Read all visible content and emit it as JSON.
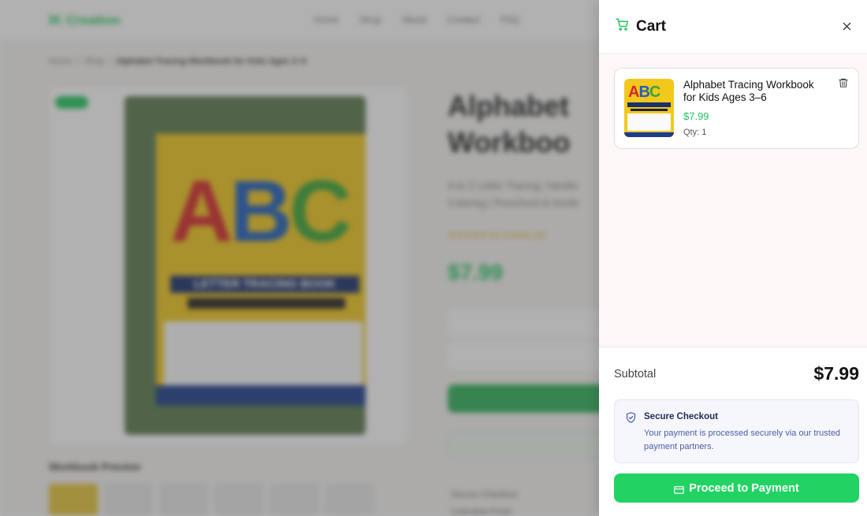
{
  "background": {
    "brand": "IK Creation",
    "nav": [
      "Home",
      "Shop",
      "About",
      "Contact",
      "FAQ"
    ],
    "breadcrumb": [
      "Home",
      "Shop",
      "Alphabet Tracing Workbook for Kids Ages 3–6"
    ],
    "badge": "SALE",
    "cover_text": "ABC",
    "cover_band": "LETTER TRACING BOOK",
    "title_line1": "Alphabet",
    "title_line2": "Workboo",
    "subtitle_line1": "A to Z Letter Tracing, Handw",
    "subtitle_line2": "Coloring | Preschool & Kinde",
    "rating_text": "No reviews yet",
    "price": "$7.99",
    "preview_heading": "Workbook Preview",
    "features": [
      "Secure Checkout",
      "Unlimited Prints"
    ]
  },
  "cart": {
    "title": "Cart",
    "item": {
      "name": "Alphabet Tracing Workbook for Kids Ages 3–6",
      "price": "$7.99",
      "qty": "Qty: 1",
      "thumb_text": "ABC"
    },
    "subtotal_label": "Subtotal",
    "subtotal_value": "$7.99",
    "secure_title": "Secure Checkout",
    "secure_text": "Your payment is processed securely via our trusted payment partners.",
    "pay_button": "Proceed to Payment"
  },
  "colors": {
    "accent_green": "#22c55e",
    "button_green": "#22d363",
    "secure_text_blue": "#4a5caa"
  }
}
